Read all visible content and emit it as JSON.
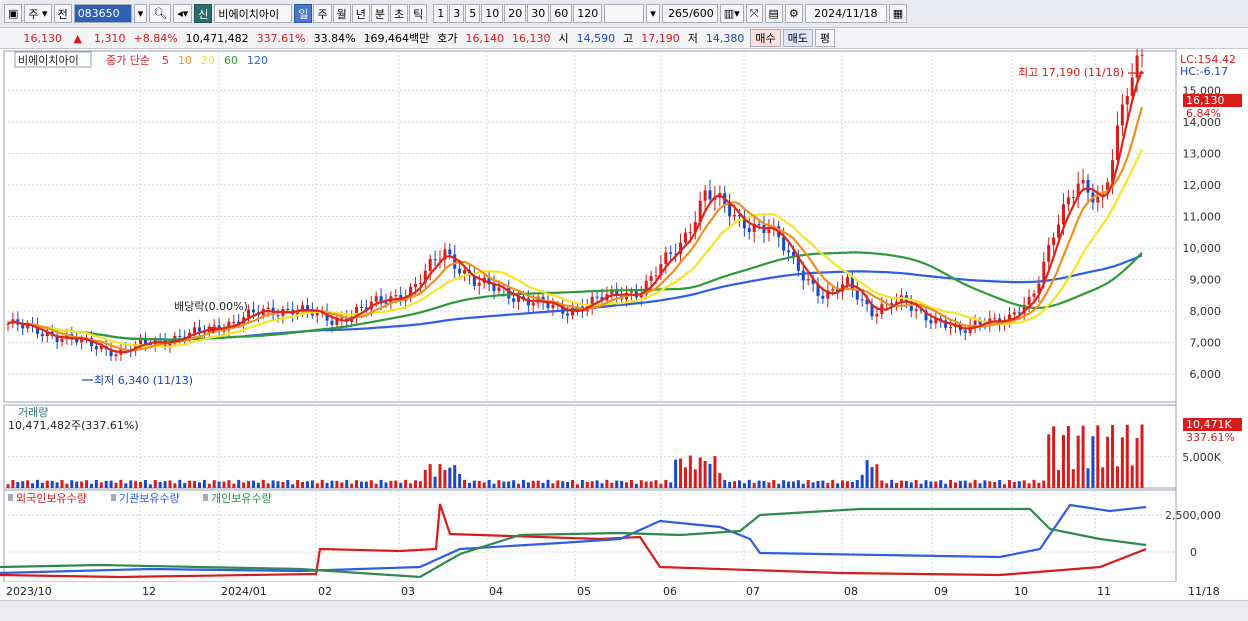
{
  "toolbar": {
    "market": "주",
    "prev": "전",
    "code": "083650",
    "badge": "신",
    "stock_name": "비에이치아이",
    "periods": [
      "일",
      "주",
      "월",
      "년",
      "분",
      "초",
      "틱"
    ],
    "active_period": "일",
    "intervals": [
      "1",
      "3",
      "5",
      "10",
      "20",
      "30",
      "60",
      "120"
    ],
    "count": "265",
    "count_max": "/600",
    "date": "2024/11/18"
  },
  "infobar": {
    "price": "16,130",
    "arrow": "▲",
    "change": "1,310",
    "change_pct": "+8.84%",
    "volume": "10,471,482",
    "volume_ratio": "337.61%",
    "turnover": "33.84%",
    "amount": "169,464백만",
    "quote_label": "호가",
    "ask": "16,140",
    "bid": "16,130",
    "open_label": "시",
    "open": "14,590",
    "high_label": "고",
    "high": "17,190",
    "low_label": "저",
    "low": "14,380",
    "buy": "매수",
    "sell": "매도",
    "eval": "평"
  },
  "price_panel": {
    "legend_name": "비에이치아이",
    "legend_ma": "종가 단순",
    "ma_periods": [
      "5",
      "10",
      "20",
      "60",
      "120"
    ],
    "lc": "LC:154.42",
    "hc": "HC:-6.17",
    "high_note": "최고 17,190 (11/18)",
    "low_note": "최저 6,340 (11/13)",
    "dividend_note": "배당락(0.00%)",
    "last_price": "16,130",
    "last_pct": "6.84%",
    "y_ticks": [
      "15,000",
      "14,000",
      "13,000",
      "12,000",
      "11,000",
      "10,000",
      "9,000",
      "8,000",
      "7,000",
      "6,000"
    ]
  },
  "volume_panel": {
    "title": "거래량",
    "value": "10,471,482주(337.61%)",
    "last": "10,471K",
    "last_pct": "337.61%",
    "y_tick": "5,000K"
  },
  "holding_panel": {
    "legend": [
      "외국인보유수량",
      "기관보유수량",
      "개인보유수량"
    ],
    "y_ticks": [
      "2,500,000",
      "0"
    ]
  },
  "x_axis": [
    "2023/10",
    "12",
    "2024/01",
    "02",
    "03",
    "04",
    "05",
    "06",
    "07",
    "08",
    "09",
    "10",
    "11",
    "11/18"
  ],
  "colors": {
    "up": "#d81b1b",
    "down": "#1a47c8",
    "ma5": "#e0241a",
    "ma10": "#f0901e",
    "ma20": "#f5e628",
    "ma60": "#2e9a3a",
    "ma120": "#2e5de6",
    "foreign": "#d81b1b",
    "institution": "#2e5de6",
    "individual": "#2e8a4e"
  }
}
